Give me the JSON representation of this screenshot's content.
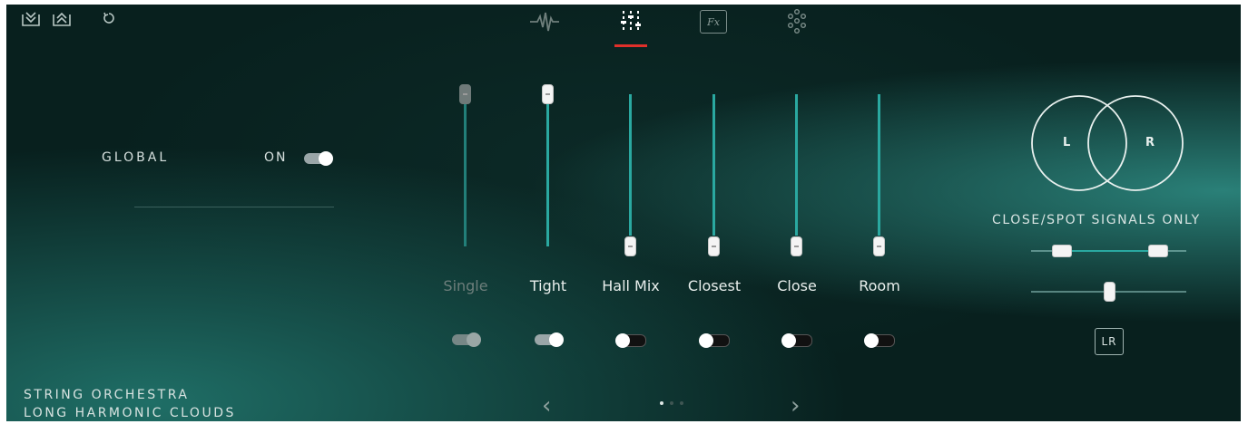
{
  "topbar": {
    "icons": [
      "save-preset-icon",
      "load-preset-icon",
      "reset-icon"
    ],
    "tabs": [
      {
        "name": "waveform-tab-icon",
        "active": false
      },
      {
        "name": "mixer-tab-icon",
        "active": true
      },
      {
        "name": "fx-tab-icon",
        "label": "Fx",
        "active": false
      },
      {
        "name": "dots-grid-tab-icon",
        "active": false
      }
    ],
    "fx_label": "Fx"
  },
  "global": {
    "label": "GLOBAL",
    "state_label": "ON",
    "on": true
  },
  "mixer": {
    "channels": [
      {
        "label": "Single",
        "level": 1.0,
        "enabled": false,
        "toggle_on": true
      },
      {
        "label": "Tight",
        "level": 1.0,
        "enabled": true,
        "toggle_on": true
      },
      {
        "label": "Hall Mix",
        "level": 0.0,
        "enabled": true,
        "toggle_on": false
      },
      {
        "label": "Closest",
        "level": 0.0,
        "enabled": true,
        "toggle_on": false
      },
      {
        "label": "Close",
        "level": 0.0,
        "enabled": true,
        "toggle_on": false
      },
      {
        "label": "Room",
        "level": 0.0,
        "enabled": true,
        "toggle_on": false
      }
    ]
  },
  "stereo": {
    "left_label": "L",
    "right_label": "R",
    "title": "CLOSE/SPOT SIGNALS ONLY",
    "width_range": [
      0.2,
      0.82
    ],
    "pan": 0.5,
    "lr_button_label": "LR"
  },
  "preset": {
    "line1": "STRING ORCHESTRA",
    "line2": "LONG HARMONIC CLOUDS"
  },
  "pager": {
    "prev_icon": "chevron-left-icon",
    "next_icon": "chevron-right-icon",
    "prev_glyph": "‹",
    "next_glyph": "›",
    "page_count": 3,
    "current_page": 1
  },
  "colors": {
    "accent_teal": "#2aa8a0",
    "tab_indicator_red": "#e0302a",
    "background": "#0a2523"
  }
}
